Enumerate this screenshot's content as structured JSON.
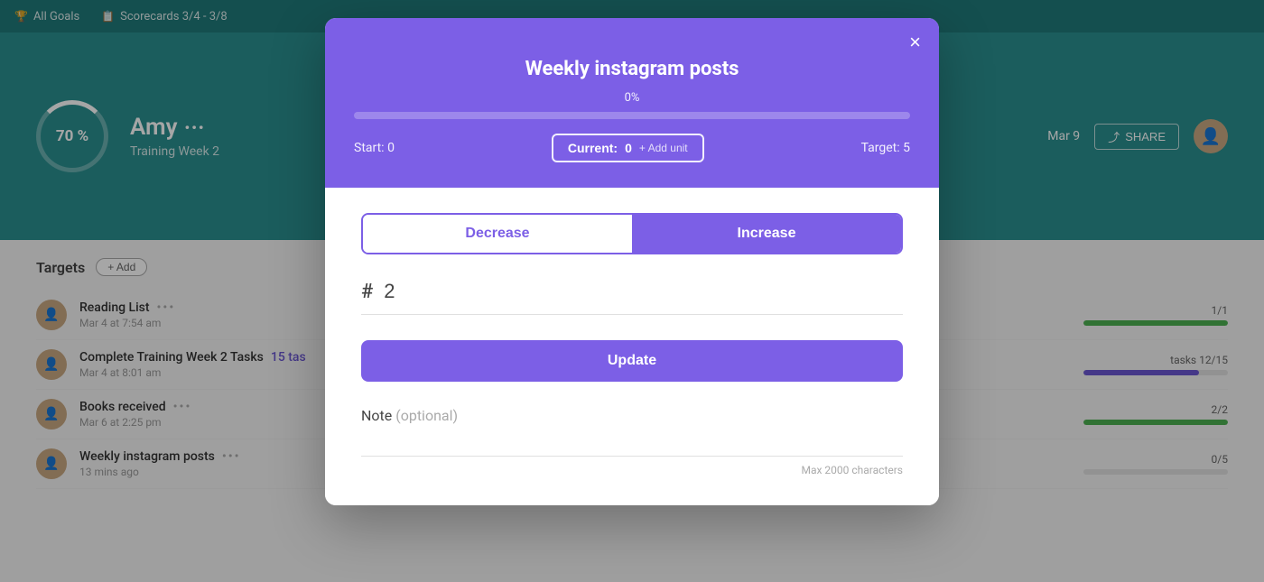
{
  "nav": {
    "all_goals_label": "All Goals",
    "scorecards_label": "Scorecards 3/4 - 3/8"
  },
  "header": {
    "progress_percent": "70 %",
    "user_name": "Amy",
    "user_dots": "•••",
    "user_subtitle": "Training Week 2",
    "date_label": "Mar 9",
    "share_label": "SHARE"
  },
  "targets_section": {
    "title": "Targets",
    "add_button": "+ Add",
    "items": [
      {
        "name": "Reading List",
        "dots": "•••",
        "date": "Mar 4 at 7:54 am",
        "count": "1/1",
        "bar_pct": 100,
        "bar_type": "green"
      },
      {
        "name": "Complete Training Week 2 Tasks",
        "link_text": "15 tas",
        "dots": "",
        "date": "Mar 4 at 8:01 am",
        "count": "tasks  12/15",
        "bar_pct": 80,
        "bar_type": "purple"
      },
      {
        "name": "Books received",
        "dots": "•••",
        "date": "Mar 6 at 2:25 pm",
        "count": "2/2",
        "bar_pct": 100,
        "bar_type": "green"
      },
      {
        "name": "Weekly instagram posts",
        "dots": "•••",
        "date": "13 mins ago",
        "count": "0/5",
        "bar_pct": 0,
        "bar_type": "green"
      }
    ]
  },
  "modal": {
    "title": "Weekly instagram posts",
    "close_label": "×",
    "progress_percent": "0%",
    "start_label": "Start:",
    "start_value": "0",
    "current_label": "Current:",
    "current_value": "0",
    "add_unit_label": "+ Add unit",
    "target_label": "Target:",
    "target_value": "5",
    "decrease_label": "Decrease",
    "increase_label": "Increase",
    "number_hash": "#",
    "number_value": "2",
    "update_label": "Update",
    "note_label": "Note",
    "note_optional": "(optional)",
    "note_placeholder": "",
    "note_max": "Max 2000 characters"
  },
  "colors": {
    "teal_dark": "#1f7a7a",
    "teal": "#2a9090",
    "purple": "#7c5fe6",
    "green": "#4caf50"
  }
}
